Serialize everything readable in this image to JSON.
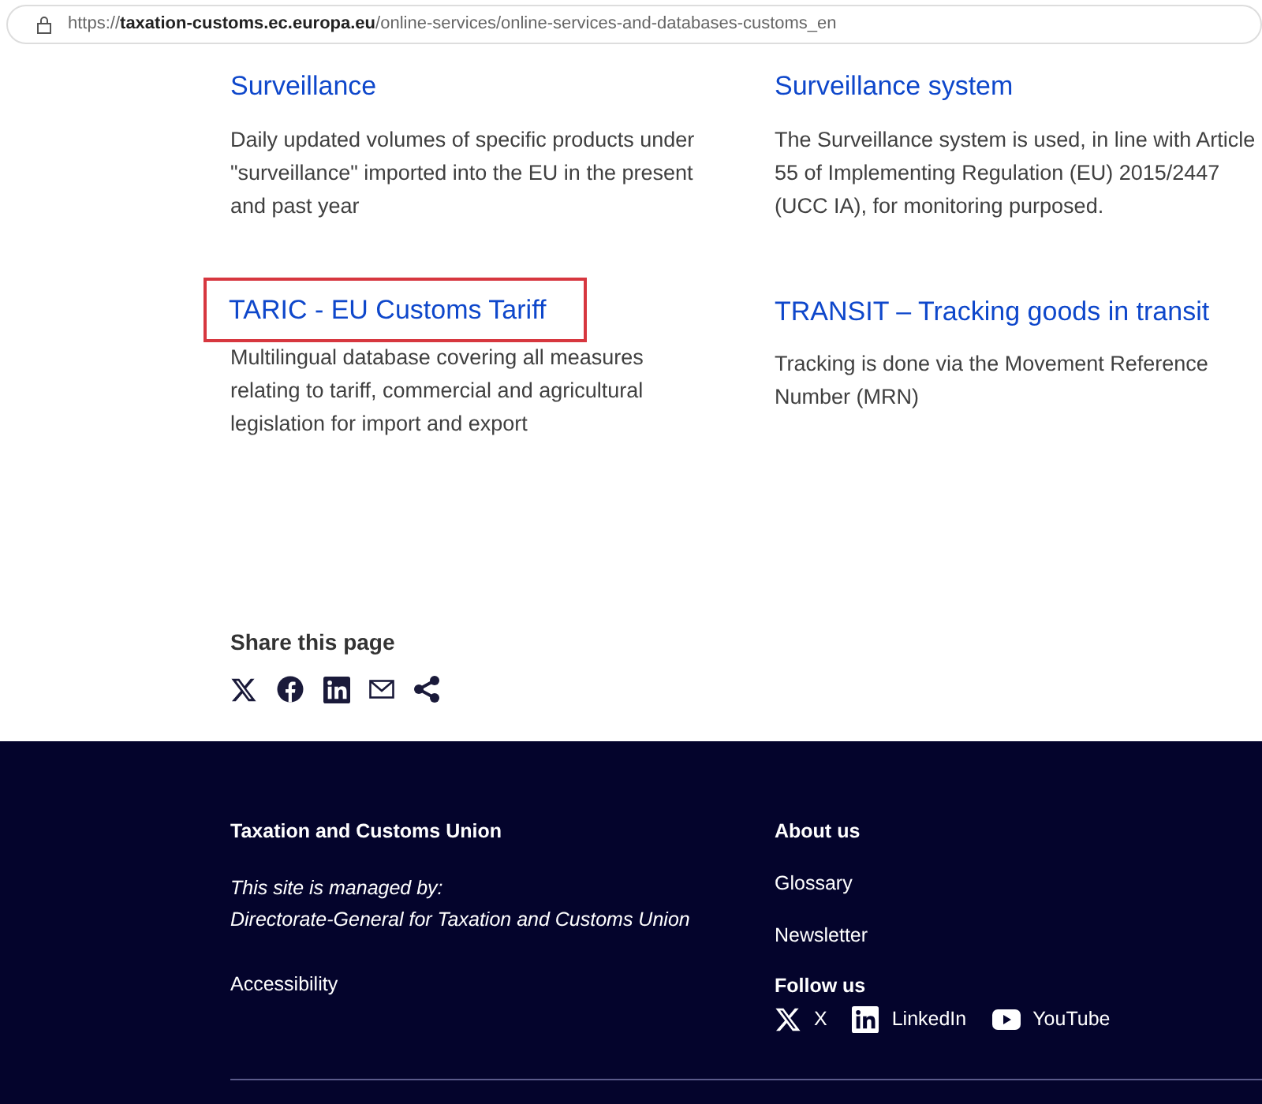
{
  "address_bar": {
    "url": "https://**taxation-customs.ec.europa.eu**/online-services/online-services-and-databases-customs_en"
  },
  "services": [
    {
      "title": "Surveillance",
      "description": "Daily updated volumes of specific products under \"surveillance\" imported into the EU in the present and past year",
      "highlighted": false
    },
    {
      "title": "Surveillance system",
      "description": "The Surveillance system is used, in line with Article 55 of Implementing Regulation (EU) 2015/2447 (UCC IA), for monitoring purposed.",
      "highlighted": false
    },
    {
      "title": "TARIC - EU Customs Tariff",
      "description": "Multilingual database covering all measures relating to tariff, commercial and agricultural legislation for import and export",
      "highlighted": true
    },
    {
      "title": "TRANSIT – Tracking goods in transit",
      "description": "Tracking is done via the Movement Reference Number (MRN)",
      "highlighted": false
    }
  ],
  "share": {
    "heading": "Share this page",
    "icons": [
      {
        "kind": "x"
      },
      {
        "kind": "facebook"
      },
      {
        "kind": "linkedin"
      },
      {
        "kind": "email"
      },
      {
        "kind": "share"
      }
    ]
  },
  "footer": {
    "site_title": "Taxation and Customs Union",
    "managed_by": "This site is managed by:\nDirectorate-General for Taxation and Customs Union",
    "left_links": [
      "Accessibility"
    ],
    "right_links": [
      "About us",
      "Glossary",
      "Newsletter"
    ],
    "follow_heading": "Follow us",
    "social": [
      {
        "kind": "x",
        "label": "X"
      },
      {
        "kind": "linkedin",
        "label": "LinkedIn"
      },
      {
        "kind": "youtube",
        "label": "YouTube"
      }
    ]
  }
}
